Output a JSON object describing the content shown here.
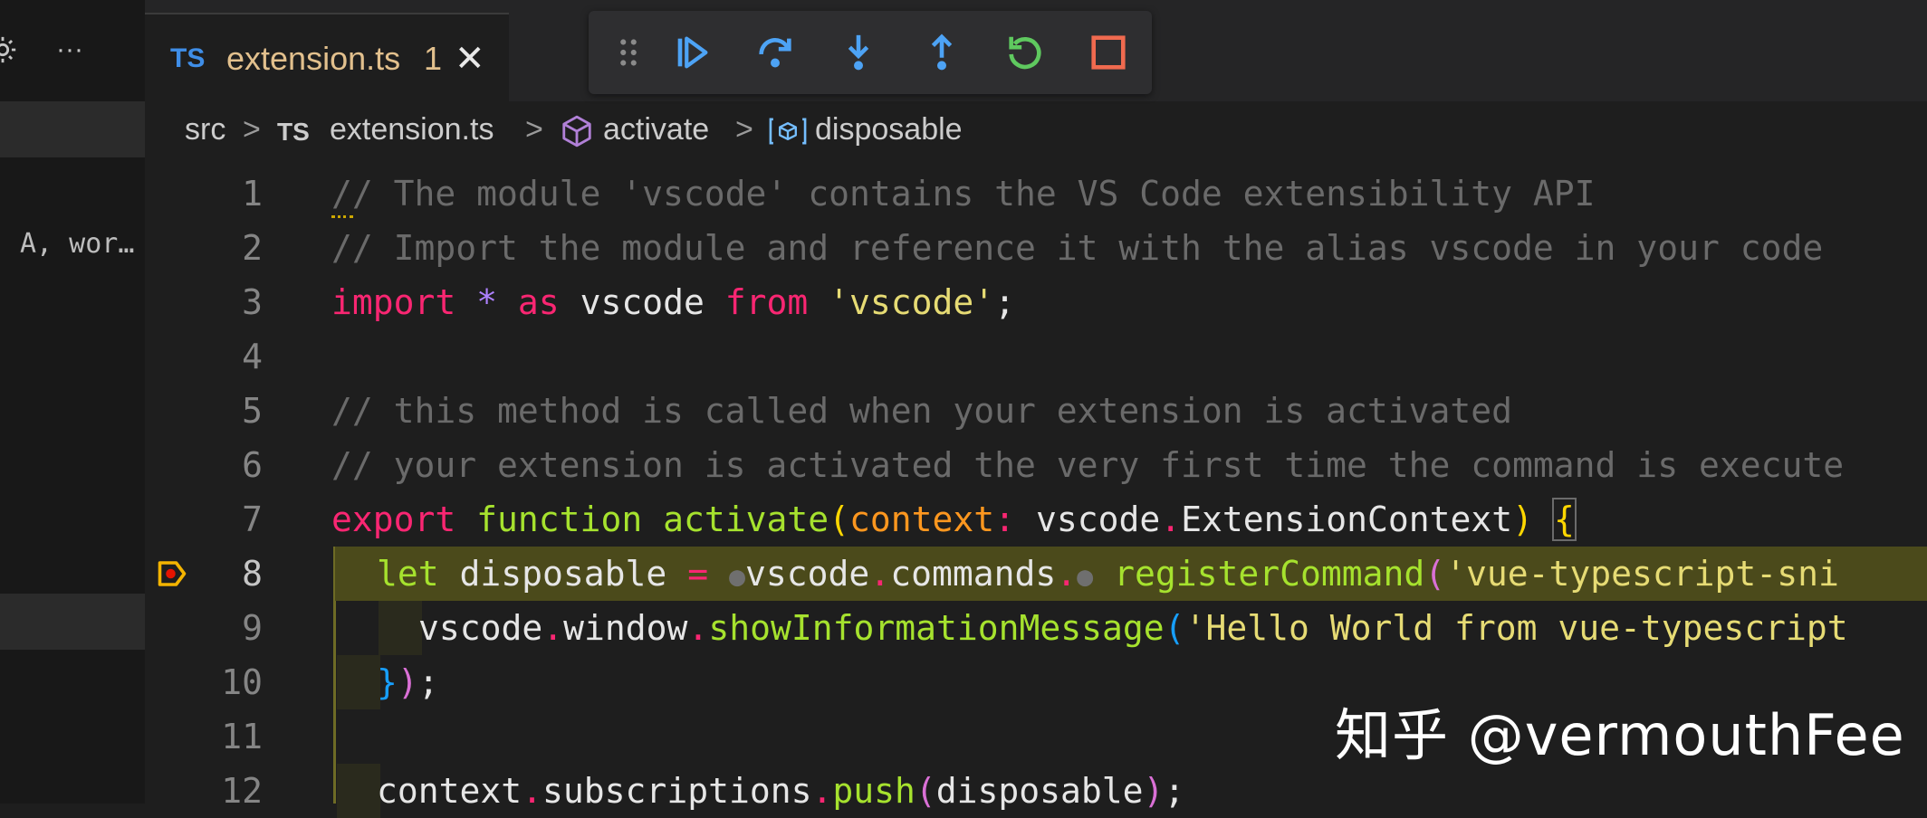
{
  "sidebar": {
    "more_glyph": "···",
    "truncated_item": "A, wor…"
  },
  "tab": {
    "lang_badge": "TS",
    "filename": "extension.ts",
    "problem_count": "1",
    "close_glyph": "✕"
  },
  "debug_toolbar": {
    "actions": [
      "continue",
      "step-over",
      "step-into",
      "step-out",
      "restart",
      "stop"
    ]
  },
  "breadcrumb": {
    "folder": "src",
    "file_badge": "TS",
    "file": "extension.ts",
    "function": "activate",
    "variable": "disposable",
    "sep": ">"
  },
  "editor": {
    "line_numbers": [
      "1",
      "2",
      "3",
      "4",
      "5",
      "6",
      "7",
      "8",
      "9",
      "10",
      "11",
      "12"
    ],
    "line1": "// The module 'vscode' contains the VS Code extensibility API",
    "line2": "// Import the module and reference it with the alias vscode in your code",
    "line3": {
      "kw1": "import",
      "op": " * ",
      "kw2": "as",
      "name": " vscode ",
      "kw3": "from",
      "str": " 'vscode'",
      "end": ";"
    },
    "line5": "// this method is called when your extension is activated",
    "line6": "// your extension is activated the very first time the command is execute",
    "line7": {
      "kw": "export",
      "fn_kw": "function",
      "fn": "activate",
      "open": "(",
      "param": "context",
      "colon": ":",
      "ns": " vscode",
      "dot": ".",
      "type": "ExtensionContext",
      "close": ")",
      "brace": "{"
    },
    "line8": {
      "kw": "let",
      "name": " disposable ",
      "eq": "=",
      "dot_marker": "●",
      "ns": "vscode",
      "dot1": ".",
      "obj": "commands",
      "dot2": ".",
      "fn": "registerCommand",
      "open": "(",
      "str": "'vue-typescript-sni"
    },
    "line9": {
      "ns": "vscode",
      "dot1": ".",
      "obj": "window",
      "dot2": ".",
      "fn": "showInformationMessage",
      "open": "(",
      "str": "'Hello World from vue-typescript"
    },
    "line10": {
      "brace": "}",
      "paren": ")",
      "semi": ";"
    },
    "line12": {
      "ns": "context",
      "dot1": ".",
      "obj": "subscriptions",
      "dot2": ".",
      "fn": "push",
      "open": "(",
      "arg": "disposable",
      "close": ")",
      "semi": ";"
    }
  },
  "watermark": "知乎 @vermouthFee",
  "colors": {
    "background": "#1e1e1e",
    "current_line": "#4b4a1b",
    "debug_blue": "#4da3f5",
    "debug_green": "#5fc95f",
    "debug_red": "#f06a4f",
    "breakpoint": "#f4b400"
  }
}
